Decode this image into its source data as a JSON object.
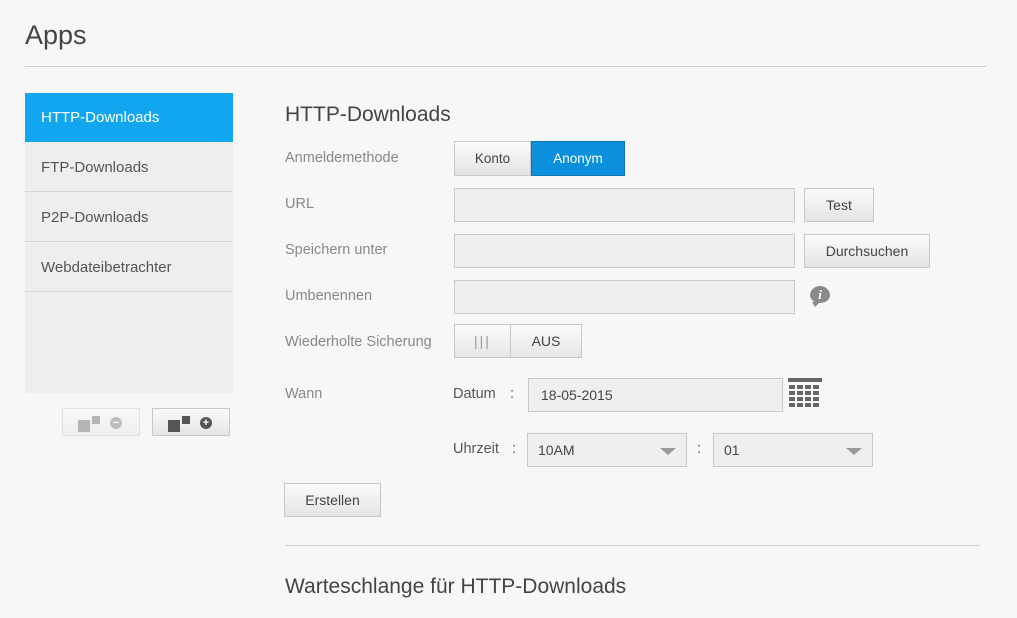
{
  "page": {
    "title": "Apps"
  },
  "sidebar": {
    "items": [
      {
        "label": "HTTP-Downloads",
        "active": true
      },
      {
        "label": "FTP-Downloads",
        "active": false
      },
      {
        "label": "P2P-Downloads",
        "active": false
      },
      {
        "label": "Webdateibetrachter",
        "active": false
      }
    ],
    "remove_app_icon": "app-remove-icon",
    "add_app_icon": "app-add-icon"
  },
  "form": {
    "title": "HTTP-Downloads",
    "login_method": {
      "label": "Anmeldemethode",
      "options": [
        "Konto",
        "Anonym"
      ],
      "selected": "Anonym"
    },
    "url": {
      "label": "URL",
      "value": "",
      "test_button": "Test"
    },
    "save_to": {
      "label": "Speichern unter",
      "value": "",
      "browse_button": "Durchsuchen"
    },
    "rename": {
      "label": "Umbenennen",
      "value": "",
      "info_icon": "info-icon"
    },
    "repeat_backup": {
      "label": "Wiederholte Sicherung",
      "handle": "|||",
      "state": "AUS"
    },
    "when": {
      "label": "Wann",
      "date_label": "Datum",
      "separator": ":",
      "date_value": "18-05-2015",
      "calendar_icon": "calendar-icon",
      "time_label": "Uhrzeit",
      "hour": "10AM",
      "minute": "01"
    },
    "create_button": "Erstellen"
  },
  "queue": {
    "title": "Warteschlange für HTTP-Downloads"
  },
  "colors": {
    "accent": "#12a6f1",
    "selected_segment": "#0c8fdc",
    "background": "#f7f7f7"
  }
}
